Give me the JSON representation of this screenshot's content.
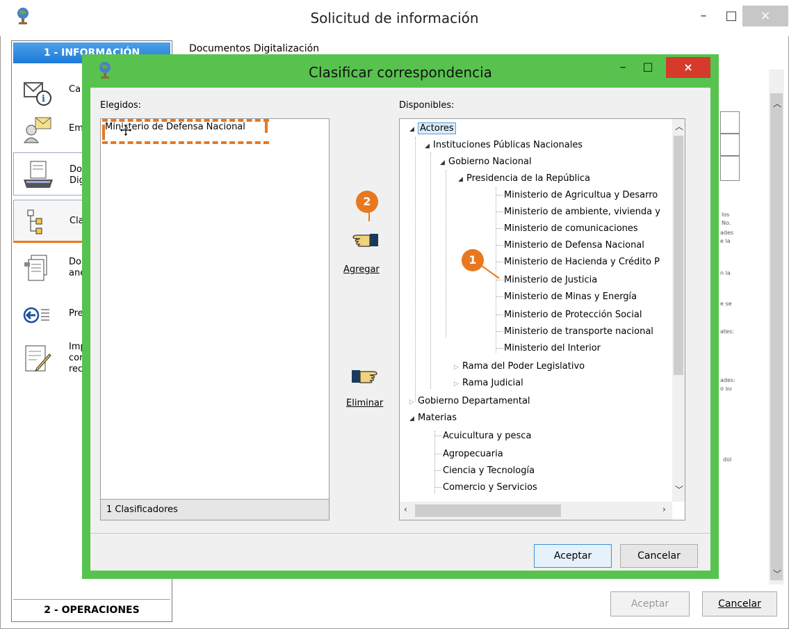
{
  "window": {
    "title": "Solicitud de información",
    "minimize": "–",
    "maximize": "□",
    "close": "×"
  },
  "left_nav": {
    "header": "1 - INFORMACIÓN",
    "footer": "2 - OPERACIONES",
    "items": [
      {
        "label": "Ca",
        "icon": "envelope-info-icon"
      },
      {
        "label": "Em",
        "icon": "sender-icon"
      },
      {
        "label": "Do\nDig",
        "icon": "scanner-icon"
      },
      {
        "label": "Cla",
        "icon": "tree-classify-icon"
      },
      {
        "label": "Do\nane",
        "icon": "documents-icon"
      },
      {
        "label": "Pre",
        "icon": "back-arrow-icon"
      },
      {
        "label": "Imp\ncor\nrec",
        "icon": "edit-document-icon"
      }
    ]
  },
  "doc_tabs": "Documentos  Digitalización",
  "outer_buttons": {
    "accept": "Aceptar",
    "cancel": "Cancelar"
  },
  "background_fragments": [
    "los",
    "No.",
    "ades",
    "e la",
    "n la",
    "e se",
    "ates:",
    "ades:",
    "o su",
    "dol"
  ],
  "dialog": {
    "title": "Clasificar correspondencia",
    "minimize": "–",
    "maximize": "□",
    "close": "×",
    "chosen_label": "Elegidos:",
    "available_label": "Disponibles:",
    "chosen_items": [
      "Ministerio de Defensa Nacional"
    ],
    "chosen_status": "1 Clasificadores",
    "add_label": "Agregar",
    "remove_label": "Eliminar",
    "accept": "Aceptar",
    "cancel": "Cancelar",
    "tree": {
      "actores": "Actores",
      "instituciones": "Instituciones Públicas Nacionales",
      "gobierno_nacional": "Gobierno Nacional",
      "presidencia": "Presidencia de la República",
      "ministerios": [
        "Ministerio de Agricultua y Desarro",
        "Ministerio de ambiente, vivienda y",
        "Ministerio de comunicaciones",
        "Ministerio de Defensa Nacional",
        "Ministerio de Hacienda y Crédito P",
        "Ministerio de Justicia",
        "Ministerio de Minas y Energía",
        "Ministerio de Protección Social",
        "Ministerio de transporte nacional",
        "Ministerio del Interior"
      ],
      "rama_legislativa": "Rama del Poder Legislativo",
      "rama_judicial": "Rama Judicial",
      "gobierno_departamental": "Gobierno Departamental",
      "materias": "Materias",
      "materias_items": [
        "Acuicultura y pesca",
        "Agropecuaria",
        "Ciencia y Tecnología",
        "Comercio y Servicios"
      ]
    },
    "badges": {
      "step1": "1",
      "step2": "2"
    }
  },
  "colors": {
    "accent": "#e8781f",
    "dialog_frame": "#57c34e",
    "header_blue": "#1c7ad8",
    "close_red": "#d53a2b"
  }
}
